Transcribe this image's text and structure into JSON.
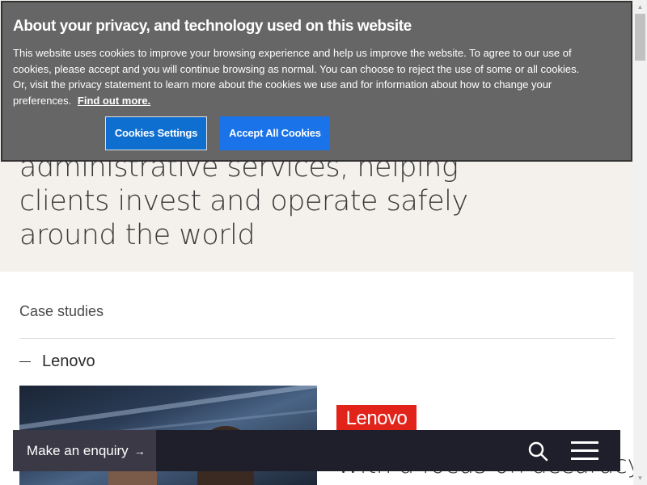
{
  "hero": {
    "text": "administrative services, helping clients invest and operate safely around the world"
  },
  "case_studies": {
    "label": "Case studies",
    "accordion_label": "Lenovo",
    "logo_text": "Lenovo",
    "quote_partial": "With a focus on accuracy,"
  },
  "cookie_banner": {
    "title": "About your privacy, and technology used on this website",
    "body": "This website uses cookies to improve your browsing experience and help us improve the website. To agree to our use of cookies, please accept and you will continue browsing as normal. You can choose to reject the use of some or all cookies. Or, visit the privacy statement to learn more about the cookies we use and for information about how to change your preferences.",
    "link": "Find out more.",
    "settings_button": "Cookies Settings",
    "accept_button": "Accept All Cookies"
  },
  "bottom_bar": {
    "enquiry_label": "Make an enquiry",
    "enquiry_arrow": "→"
  },
  "icons": {
    "search": "search-icon",
    "menu": "hamburger-menu-icon",
    "arrow": "arrow-right-icon"
  },
  "colors": {
    "banner_bg": "#666666",
    "accept_bg": "#1a73e8",
    "settings_bg": "#0f6fd0",
    "hero_bg": "#f4f1ec",
    "bar_bg": "#1f1e2b",
    "lenovo_red": "#e2231a"
  }
}
